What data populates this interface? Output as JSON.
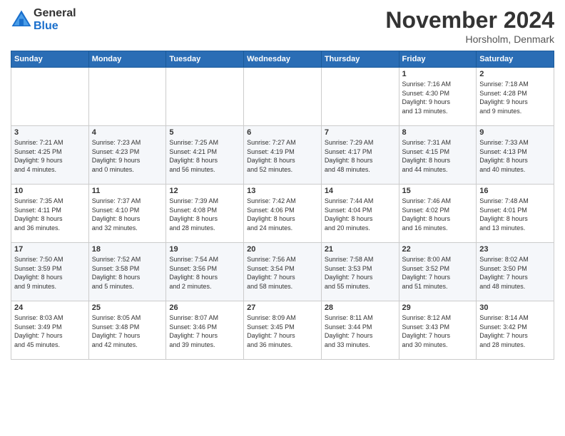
{
  "logo": {
    "general": "General",
    "blue": "Blue"
  },
  "header": {
    "month": "November 2024",
    "location": "Horsholm, Denmark"
  },
  "days_of_week": [
    "Sunday",
    "Monday",
    "Tuesday",
    "Wednesday",
    "Thursday",
    "Friday",
    "Saturday"
  ],
  "weeks": [
    [
      {
        "day": "",
        "info": ""
      },
      {
        "day": "",
        "info": ""
      },
      {
        "day": "",
        "info": ""
      },
      {
        "day": "",
        "info": ""
      },
      {
        "day": "",
        "info": ""
      },
      {
        "day": "1",
        "info": "Sunrise: 7:16 AM\nSunset: 4:30 PM\nDaylight: 9 hours\nand 13 minutes."
      },
      {
        "day": "2",
        "info": "Sunrise: 7:18 AM\nSunset: 4:28 PM\nDaylight: 9 hours\nand 9 minutes."
      }
    ],
    [
      {
        "day": "3",
        "info": "Sunrise: 7:21 AM\nSunset: 4:25 PM\nDaylight: 9 hours\nand 4 minutes."
      },
      {
        "day": "4",
        "info": "Sunrise: 7:23 AM\nSunset: 4:23 PM\nDaylight: 9 hours\nand 0 minutes."
      },
      {
        "day": "5",
        "info": "Sunrise: 7:25 AM\nSunset: 4:21 PM\nDaylight: 8 hours\nand 56 minutes."
      },
      {
        "day": "6",
        "info": "Sunrise: 7:27 AM\nSunset: 4:19 PM\nDaylight: 8 hours\nand 52 minutes."
      },
      {
        "day": "7",
        "info": "Sunrise: 7:29 AM\nSunset: 4:17 PM\nDaylight: 8 hours\nand 48 minutes."
      },
      {
        "day": "8",
        "info": "Sunrise: 7:31 AM\nSunset: 4:15 PM\nDaylight: 8 hours\nand 44 minutes."
      },
      {
        "day": "9",
        "info": "Sunrise: 7:33 AM\nSunset: 4:13 PM\nDaylight: 8 hours\nand 40 minutes."
      }
    ],
    [
      {
        "day": "10",
        "info": "Sunrise: 7:35 AM\nSunset: 4:11 PM\nDaylight: 8 hours\nand 36 minutes."
      },
      {
        "day": "11",
        "info": "Sunrise: 7:37 AM\nSunset: 4:10 PM\nDaylight: 8 hours\nand 32 minutes."
      },
      {
        "day": "12",
        "info": "Sunrise: 7:39 AM\nSunset: 4:08 PM\nDaylight: 8 hours\nand 28 minutes."
      },
      {
        "day": "13",
        "info": "Sunrise: 7:42 AM\nSunset: 4:06 PM\nDaylight: 8 hours\nand 24 minutes."
      },
      {
        "day": "14",
        "info": "Sunrise: 7:44 AM\nSunset: 4:04 PM\nDaylight: 8 hours\nand 20 minutes."
      },
      {
        "day": "15",
        "info": "Sunrise: 7:46 AM\nSunset: 4:02 PM\nDaylight: 8 hours\nand 16 minutes."
      },
      {
        "day": "16",
        "info": "Sunrise: 7:48 AM\nSunset: 4:01 PM\nDaylight: 8 hours\nand 13 minutes."
      }
    ],
    [
      {
        "day": "17",
        "info": "Sunrise: 7:50 AM\nSunset: 3:59 PM\nDaylight: 8 hours\nand 9 minutes."
      },
      {
        "day": "18",
        "info": "Sunrise: 7:52 AM\nSunset: 3:58 PM\nDaylight: 8 hours\nand 5 minutes."
      },
      {
        "day": "19",
        "info": "Sunrise: 7:54 AM\nSunset: 3:56 PM\nDaylight: 8 hours\nand 2 minutes."
      },
      {
        "day": "20",
        "info": "Sunrise: 7:56 AM\nSunset: 3:54 PM\nDaylight: 7 hours\nand 58 minutes."
      },
      {
        "day": "21",
        "info": "Sunrise: 7:58 AM\nSunset: 3:53 PM\nDaylight: 7 hours\nand 55 minutes."
      },
      {
        "day": "22",
        "info": "Sunrise: 8:00 AM\nSunset: 3:52 PM\nDaylight: 7 hours\nand 51 minutes."
      },
      {
        "day": "23",
        "info": "Sunrise: 8:02 AM\nSunset: 3:50 PM\nDaylight: 7 hours\nand 48 minutes."
      }
    ],
    [
      {
        "day": "24",
        "info": "Sunrise: 8:03 AM\nSunset: 3:49 PM\nDaylight: 7 hours\nand 45 minutes."
      },
      {
        "day": "25",
        "info": "Sunrise: 8:05 AM\nSunset: 3:48 PM\nDaylight: 7 hours\nand 42 minutes."
      },
      {
        "day": "26",
        "info": "Sunrise: 8:07 AM\nSunset: 3:46 PM\nDaylight: 7 hours\nand 39 minutes."
      },
      {
        "day": "27",
        "info": "Sunrise: 8:09 AM\nSunset: 3:45 PM\nDaylight: 7 hours\nand 36 minutes."
      },
      {
        "day": "28",
        "info": "Sunrise: 8:11 AM\nSunset: 3:44 PM\nDaylight: 7 hours\nand 33 minutes."
      },
      {
        "day": "29",
        "info": "Sunrise: 8:12 AM\nSunset: 3:43 PM\nDaylight: 7 hours\nand 30 minutes."
      },
      {
        "day": "30",
        "info": "Sunrise: 8:14 AM\nSunset: 3:42 PM\nDaylight: 7 hours\nand 28 minutes."
      }
    ]
  ]
}
